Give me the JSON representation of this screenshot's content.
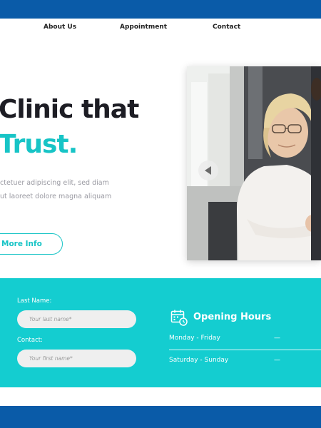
{
  "nav": {
    "about": "About Us",
    "appointment": "Appointment",
    "contact": "Contact"
  },
  "hero": {
    "title_line1": "Clinic that",
    "title_line2": "Trust.",
    "desc_line1": "ctetuer adipiscing elit, sed diam",
    "desc_line2": "ut laoreet dolore magna aliquam",
    "button_label": "More Info"
  },
  "form": {
    "last_name_label": "Last Name:",
    "last_name_placeholder": "Your last name*",
    "contact_label": "Contact:",
    "contact_placeholder": "Your first name*"
  },
  "hours": {
    "title": "Opening Hours",
    "rows": [
      {
        "day": "Monday - Friday",
        "value": "—"
      },
      {
        "day": "Saturday - Sunday",
        "value": "—"
      }
    ]
  },
  "colors": {
    "accent": "#17c4c6",
    "band": "#14cdd0",
    "frame": "#0a5ba8",
    "heading": "#1d1d24"
  },
  "icons": {
    "calendar": "calendar-clock-icon",
    "prev": "arrow-left-icon"
  }
}
